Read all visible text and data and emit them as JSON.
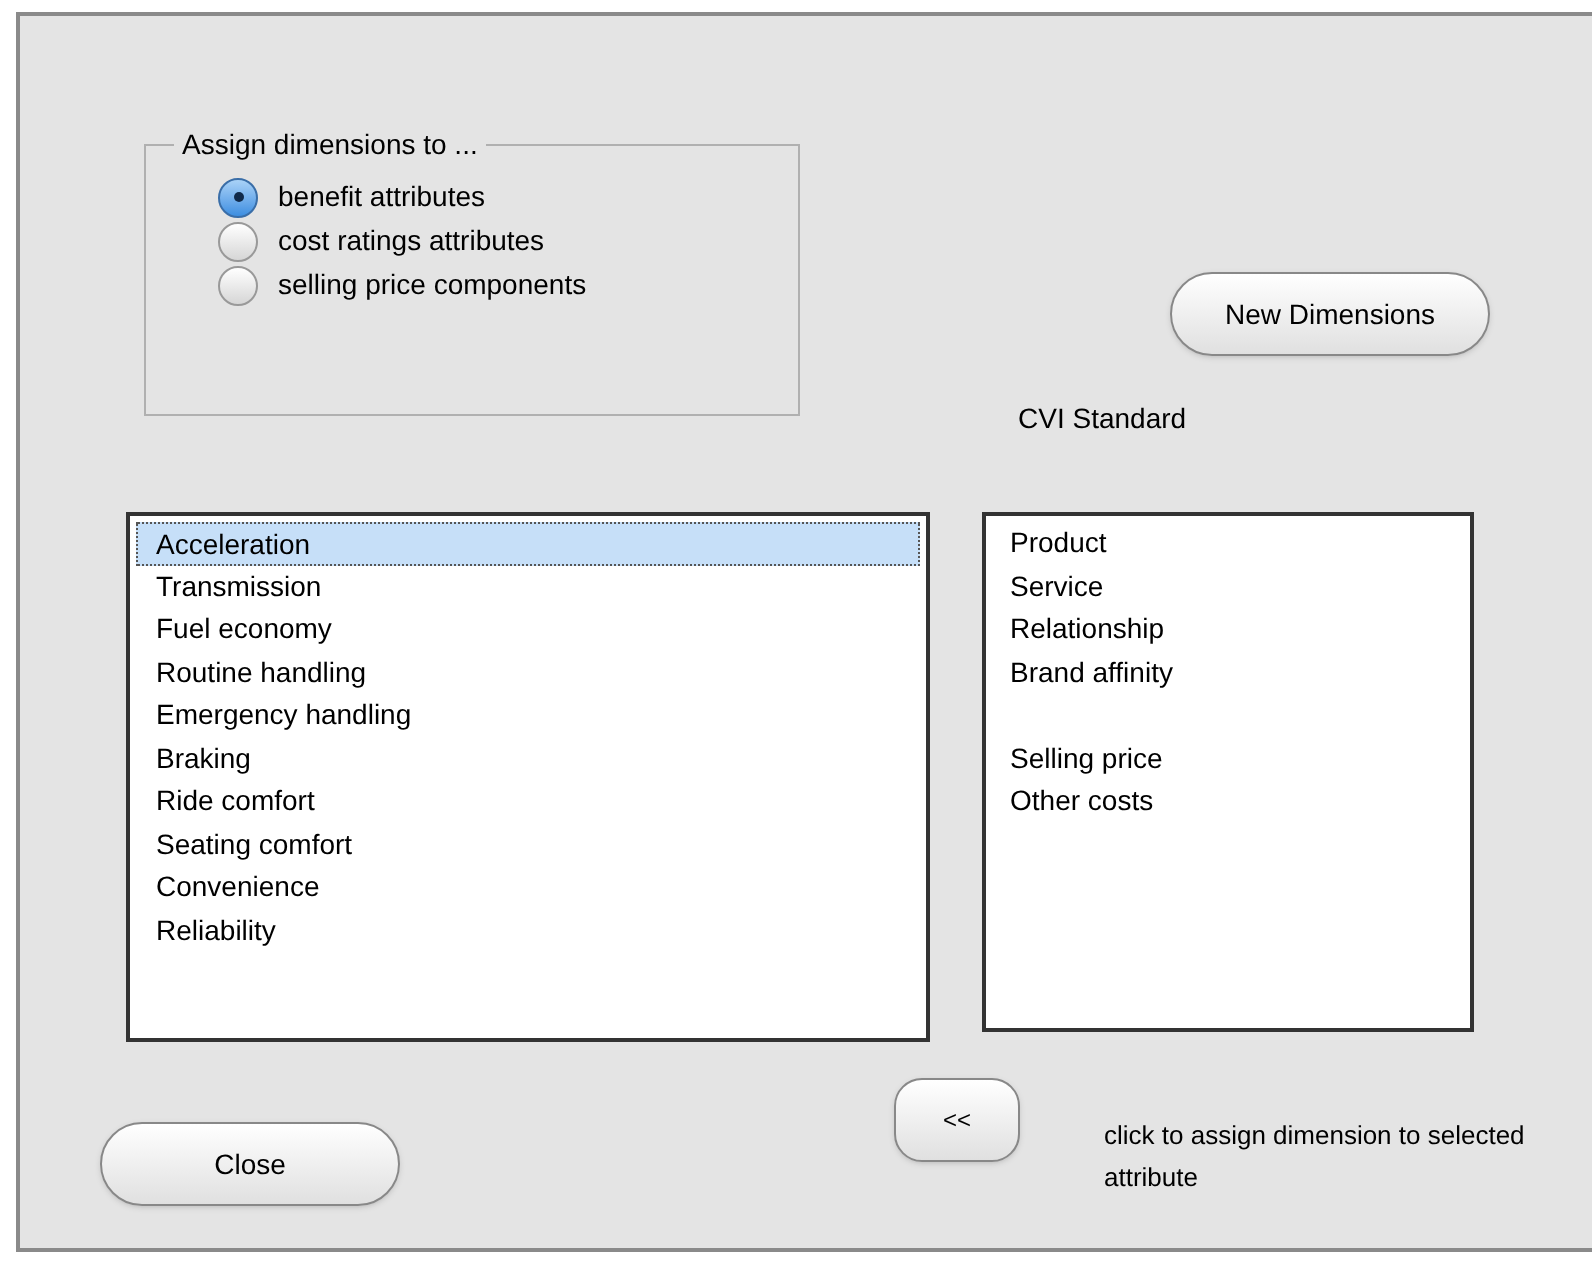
{
  "assign_group": {
    "title": "Assign dimensions to ...",
    "options": [
      {
        "label": "benefit attributes",
        "selected": true
      },
      {
        "label": "cost ratings attributes",
        "selected": false
      },
      {
        "label": "selling price components",
        "selected": false
      }
    ]
  },
  "new_dimensions_button": "New Dimensions",
  "dimension_set_label": "CVI Standard",
  "attributes": [
    {
      "label": "Acceleration",
      "selected": true
    },
    {
      "label": "Transmission",
      "selected": false
    },
    {
      "label": "Fuel economy",
      "selected": false
    },
    {
      "label": "Routine handling",
      "selected": false
    },
    {
      "label": "Emergency handling",
      "selected": false
    },
    {
      "label": "Braking",
      "selected": false
    },
    {
      "label": "Ride comfort",
      "selected": false
    },
    {
      "label": "Seating comfort",
      "selected": false
    },
    {
      "label": "Convenience",
      "selected": false
    },
    {
      "label": "Reliability",
      "selected": false
    }
  ],
  "dimension_groups": [
    [
      "Product",
      "Service",
      "Relationship",
      "Brand affinity"
    ],
    [
      "Selling price",
      "Other costs"
    ]
  ],
  "assign_button": "<<",
  "assign_hint": "click to assign dimension to selected attribute",
  "close_button": "Close"
}
